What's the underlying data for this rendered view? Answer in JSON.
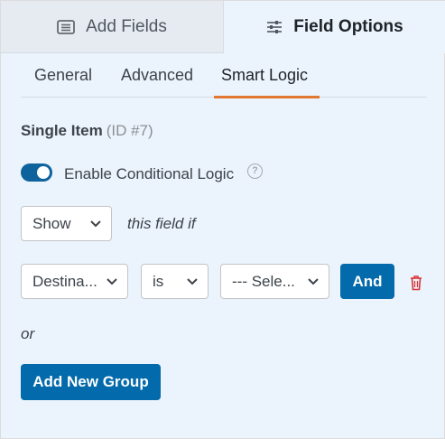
{
  "top_tabs": [
    {
      "label": "Add Fields",
      "icon": "list-icon",
      "active": false
    },
    {
      "label": "Field Options",
      "icon": "sliders-icon",
      "active": true
    }
  ],
  "sub_tabs": [
    {
      "label": "General",
      "active": false
    },
    {
      "label": "Advanced",
      "active": false
    },
    {
      "label": "Smart Logic",
      "active": true
    }
  ],
  "field": {
    "name": "Single Item",
    "id_label": "(ID #7)"
  },
  "conditional_logic": {
    "toggle_label": "Enable Conditional Logic",
    "enabled": true,
    "help_icon": "question-circle-icon",
    "action_value": "Show",
    "action_suffix": "this field if"
  },
  "rule": {
    "field_value": "Destina...",
    "operator_value": "is",
    "value_value": "--- Sele...",
    "and_label": "And",
    "delete_icon": "trash-icon"
  },
  "or_label": "or",
  "add_group_label": "Add New Group",
  "colors": {
    "accent_blue": "#036aab",
    "tab_underline": "#e27730",
    "delete_red": "#d63638",
    "panel_bg": "#ebf3fc"
  }
}
